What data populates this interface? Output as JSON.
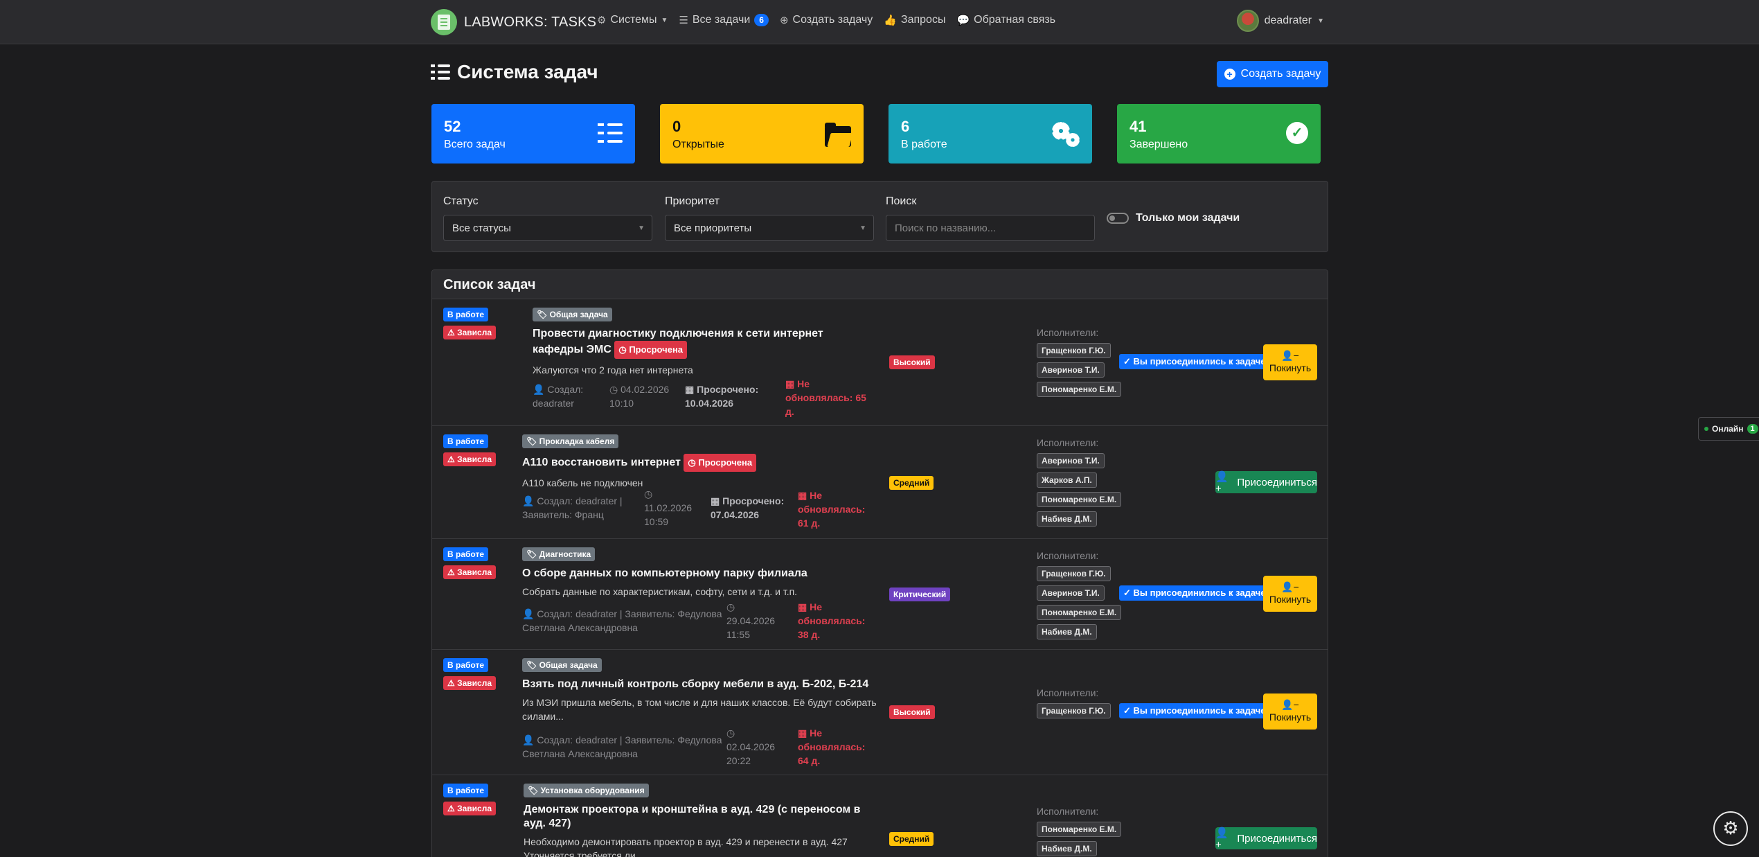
{
  "nav": {
    "brand": "LABWORKS: TASKS",
    "systems": "Системы",
    "all_tasks": "Все задачи",
    "all_tasks_count": "6",
    "create_task": "Создать задачу",
    "requests": "Запросы",
    "feedback": "Обратная связь",
    "user": "deadrater"
  },
  "header": {
    "title": "Система задач",
    "create_button": "Создать задачу"
  },
  "stats": [
    {
      "value": "52",
      "label": "Всего задач"
    },
    {
      "value": "0",
      "label": "Открытые"
    },
    {
      "value": "6",
      "label": "В работе"
    },
    {
      "value": "41",
      "label": "Завершено"
    }
  ],
  "filters": {
    "status_label": "Статус",
    "status_value": "Все статусы",
    "priority_label": "Приоритет",
    "priority_value": "Все приоритеты",
    "search_label": "Поиск",
    "search_placeholder": "Поиск по названию...",
    "my_tasks_label": "Только мои задачи"
  },
  "list_title": "Список задач",
  "executors_label": "Исполнители:",
  "joined_label": "Вы присоединились к задаче",
  "leave_label": "Покинуть",
  "join_label": "Присоединиться",
  "overdue_badge": "Просрочена",
  "tasks": [
    {
      "status": "В работе",
      "stuck": "Зависла",
      "category": "Общая задача",
      "title": "Провести диагностику подключения к сети интернет кафедры ЭМС",
      "desc": "Жалуются что 2 года нет интернета",
      "created_label": "Создал:",
      "created_by": "deadrater",
      "date": "04.02.2026",
      "time": "10:10",
      "overdue_label": "Просрочено:",
      "overdue_date": "10.04.2026",
      "stale": "Не обновлялась: 65 д.",
      "priority": "Высокий",
      "executors": [
        "Гращенков Г.Ю.",
        "Аверинов Т.И.",
        "Пономаренко Е.М."
      ]
    },
    {
      "status": "В работе",
      "stuck": "Зависла",
      "category": "Прокладка кабеля",
      "title": "А110 восстановить интернет",
      "desc": "А110 кабель не подключен",
      "created_line1": "Создал: deadrater |",
      "created_line2": "Заявитель: Франц",
      "date": "11.02.2026",
      "time": "10:59",
      "overdue_label": "Просрочено:",
      "overdue_date": "07.04.2026",
      "stale_l1": "Не",
      "stale_l2": "обновлялась:",
      "stale_l3": "61 д.",
      "priority": "Средний",
      "executors": [
        "Аверинов Т.И.",
        "Жарков А.П.",
        "Пономаренко Е.М.",
        "Набиев Д.М."
      ]
    },
    {
      "status": "В работе",
      "stuck": "Зависла",
      "category": "Диагностика",
      "title": "О сборе данных по компьютерному парку филиала",
      "desc": "Собрать данные по характеристикам, софту, сети и т.д. и т.п.",
      "created_line1": "Создал: deadrater | Заявитель: Федулова",
      "created_line2": "Светлана Александровна",
      "date": "29.04.2026",
      "time": "11:55",
      "stale_l1": "Не",
      "stale_l2": "обновлялась:",
      "stale_l3": "38 д.",
      "priority": "Критический",
      "executors": [
        "Гращенков Г.Ю.",
        "Аверинов Т.И.",
        "Пономаренко Е.М.",
        "Набиев Д.М."
      ]
    },
    {
      "status": "В работе",
      "stuck": "Зависла",
      "category": "Общая задача",
      "title": "Взять под личный контроль сборку мебели в ауд. Б-202, Б-214",
      "desc_l1": "Из МЭИ пришла мебель, в том числе и для наших классов. Её будут собирать",
      "desc_l2": "силами...",
      "created_line1": "Создал: deadrater | Заявитель: Федулова",
      "created_line2": "Светлана Александровна",
      "date": "02.04.2026",
      "time": "20:22",
      "stale_l1": "Не",
      "stale_l2": "обновлялась:",
      "stale_l3": "64 д.",
      "priority": "Высокий",
      "executors": [
        "Гращенков Г.Ю."
      ]
    },
    {
      "status": "В работе",
      "stuck": "Зависла",
      "category": "Установка оборудования",
      "title_l1": "Демонтаж проектора и кронштейна в ауд. 429 (с переносом в",
      "title_l2": "ауд. 427)",
      "desc_l1": "Необходимо демонтировать проектор в ауд. 429 и перенести в ауд. 427",
      "desc_l2": "Уточняется требуется ли...",
      "priority": "Средний",
      "executors": [
        "Пономаренко Е.М.",
        "Набиев Д.М."
      ]
    }
  ],
  "online": {
    "label": "Онлайн",
    "count": "1"
  },
  "colors": {
    "primary": "#0d6efd",
    "warning": "#ffc107",
    "info": "#17a2b8",
    "success": "#28a745",
    "danger": "#dc3545",
    "purple": "#6f42c1"
  }
}
